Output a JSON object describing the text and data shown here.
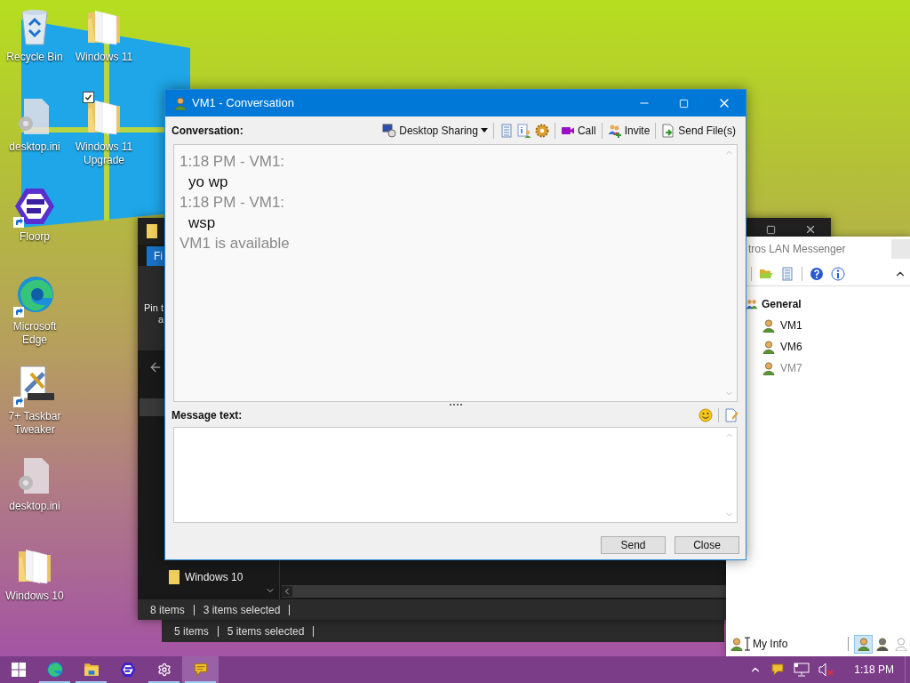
{
  "desktop": {
    "columns": [
      [
        {
          "label": "Recycle Bin",
          "kind": "recycle",
          "checked": false
        },
        {
          "label": "desktop.ini",
          "kind": "ini",
          "checked": false
        },
        {
          "label": "Floorp",
          "kind": "floorp",
          "checked": false
        },
        {
          "label": "Microsoft Edge",
          "kind": "edge",
          "checked": false
        },
        {
          "label": "7+ Taskbar Tweaker",
          "kind": "tweaker",
          "checked": false
        },
        {
          "label": "desktop.ini",
          "kind": "ini",
          "checked": false
        },
        {
          "label": "Windows 10",
          "kind": "folder",
          "checked": false
        }
      ],
      [
        {
          "label": "Windows 11",
          "kind": "folder",
          "checked": false
        },
        {
          "label": "Windows 11 Upgrade",
          "kind": "folder",
          "checked": true
        }
      ]
    ]
  },
  "explorer_back": {
    "status": [
      "5 items",
      "5 items selected"
    ]
  },
  "explorer": {
    "ribbon_tab": "Fi",
    "pin_text": [
      "Pin t",
      "a"
    ],
    "nav_items": [
      {
        "label": "Windows 10",
        "kind": "folder"
      }
    ],
    "status": [
      "8 items",
      "3 items selected"
    ]
  },
  "messenger": {
    "title": "tros LAN Messenger",
    "groups": [
      {
        "label": "General",
        "children": [
          {
            "label": "VM1",
            "online": true
          },
          {
            "label": "VM6",
            "online": true
          },
          {
            "label": "VM7",
            "online": false
          }
        ]
      }
    ],
    "my_info": "My Info",
    "status_buttons": [
      {
        "kind": "online",
        "selected": true
      },
      {
        "kind": "busy",
        "selected": false
      },
      {
        "kind": "offline",
        "selected": false
      }
    ]
  },
  "conversation": {
    "title": "VM1 - Conversation",
    "conversation_label": "Conversation:",
    "toolbar_groups": [
      [
        {
          "kind": "desktop-sharing",
          "label": "Desktop Sharing",
          "dropdown": true
        }
      ],
      [
        {
          "kind": "history"
        },
        {
          "kind": "info"
        },
        {
          "kind": "settings"
        }
      ],
      [
        {
          "kind": "call",
          "label": "Call"
        }
      ],
      [
        {
          "kind": "invite",
          "label": "Invite"
        }
      ],
      [
        {
          "kind": "send-file",
          "label": "Send File(s)"
        }
      ]
    ],
    "messages": [
      {
        "kind": "header",
        "text": "1:18 PM - VM1:"
      },
      {
        "kind": "body",
        "text": "yo wp"
      },
      {
        "kind": "header",
        "text": "1:18 PM - VM1:"
      },
      {
        "kind": "body",
        "text": "wsp"
      },
      {
        "kind": "status",
        "text": "VM1 is available"
      }
    ],
    "message_label": "Message text:",
    "buttons": [
      "Send",
      "Close"
    ]
  },
  "taskbar": {
    "apps": [
      {
        "kind": "start",
        "running": false,
        "selected": false
      },
      {
        "kind": "edge",
        "running": true,
        "selected": false
      },
      {
        "kind": "explorer",
        "running": true,
        "selected": false
      },
      {
        "kind": "floorp",
        "running": false,
        "selected": false
      },
      {
        "kind": "settings",
        "running": true,
        "selected": false
      },
      {
        "kind": "messenger",
        "running": true,
        "selected": true
      }
    ],
    "time": "1:18 PM"
  }
}
